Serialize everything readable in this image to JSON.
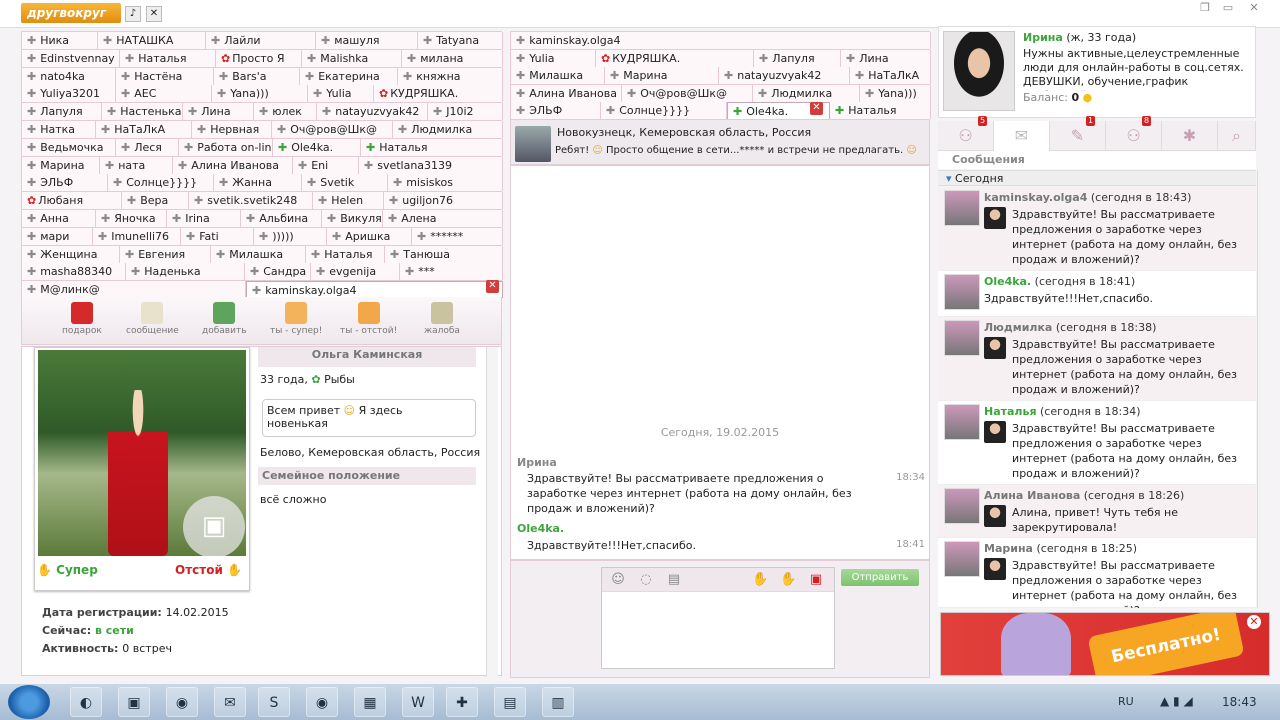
{
  "app": {
    "logo": "другвокруг"
  },
  "left_tabs": [
    [
      "Ника",
      "НАТАШКА",
      "Лайли",
      "машуля",
      "Tatyana"
    ],
    [
      "Edinstvennay",
      "Наталья",
      "Просто Я",
      "Malishka",
      "милана"
    ],
    [
      "nato4ka",
      "Настёна",
      "Bars'a",
      "Екатерина",
      "княжна"
    ],
    [
      "Yuliya3201",
      "AEC",
      "Yana)))",
      "Yulia",
      "КУДРЯШКА."
    ],
    [
      "Лапуля",
      "Настенька",
      "Лина",
      "юлек",
      "natayuzvyak42",
      "J10i2"
    ],
    [
      "Натка",
      "НаТаЛкА",
      "Нервная",
      "Оч@ров@Шк@",
      "Людмилка"
    ],
    [
      "Ведьмочка",
      "Леся",
      "Работа on-line",
      "Ole4ka.",
      "Наталья"
    ],
    [
      "Марина",
      "ната",
      "Алина Иванова",
      "Eni",
      "svetlana3139"
    ],
    [
      "ЭЛЬФ",
      "Солнце}}}}",
      "Жанна",
      "Svetik",
      "misiskos"
    ],
    [
      "Любаня",
      "Вера",
      "svetik.svetik248",
      "Helen",
      "ugiljon76"
    ],
    [
      "Анна",
      "Яночка",
      "Irina",
      "Альбина",
      "Викуля",
      "Алена"
    ],
    [
      "мари",
      "Imunelli76",
      "Fati",
      ")))))",
      "Аришка",
      "******"
    ],
    [
      "Женщина",
      "Евгения",
      "Милашка",
      "Наталья",
      "Танюша"
    ],
    [
      "masha88340",
      "Наденька",
      "Сандра",
      "evgenija",
      "***"
    ],
    [
      "M@линк@",
      "kaminskay.olga4"
    ]
  ],
  "toolbar": {
    "gift": "подарок",
    "message": "сообщение",
    "add": "добавить",
    "super": "ты - супер!",
    "bad": "ты - отстой!",
    "complaint": "жалоба"
  },
  "profile": {
    "name": "Ольга Каминская",
    "age_sign": "33 года,",
    "zodiac": "Рыбы",
    "status_msg": "Всем привет",
    "status_msg2": "Я здесь",
    "status_msg3": "новенькая",
    "location": "Белово, Кемеровская область, Россия",
    "family_header": "Семейное положение",
    "family_value": "всё сложно",
    "vote_super": "Супер",
    "vote_bad": "Отстой",
    "reg_label": "Дата регистрации:",
    "reg_value": "14.02.2015",
    "now_label": "Сейчас:",
    "now_value": "в сети",
    "activity_label": "Активность:",
    "activity_value": "0 встреч"
  },
  "mid_tabs": [
    [
      "kaminskay.olga4"
    ],
    [
      "Yulia",
      "КУДРЯШКА.",
      "Лапуля",
      "Лина"
    ],
    [
      "Милашка",
      "Марина",
      "natayuzvyak42",
      "НаТаЛкА"
    ],
    [
      "Алина Иванова",
      "Оч@ров@Шк@",
      "Людмилка",
      "Yana)))"
    ],
    [
      "ЭЛЬФ",
      "Солнце}}}}",
      "Ole4ka.",
      "Наталья"
    ]
  ],
  "chat": {
    "location": "Новокузнецк, Кемеровская область, Россия",
    "status": "Ребят!",
    "status2": "Просто общение в сети...***** и встречи не предлагать.",
    "date": "Сегодня, 19.02.2015",
    "m1_name": "Ирина",
    "m1_text": "Здравствуйте! Вы рассматриваете предложения о заработке через интернет (работа на дому онлайн, без продаж и вложений)?",
    "m1_time": "18:34",
    "m2_name": "Ole4ka.",
    "m2_text": "Здравствуйте!!!Нет,спасибо.",
    "m2_time": "18:41",
    "send": "Отправить"
  },
  "me": {
    "name": "Ирина",
    "info": "(ж, 33 года)",
    "about": "Нужны активные,целеустремленные люди для онлайн-работы в соц.сетях. ДЕВУШКИ, обучение,график свободный",
    "balance_label": "Баланс:",
    "balance": "0"
  },
  "rtabs": {
    "b1": "5",
    "b3": "1",
    "b4": "8"
  },
  "messages_header": "Сообщения",
  "today": "Сегодня",
  "messages": [
    {
      "name": "kaminskay.olga4",
      "when": "(сегодня в 18:43)",
      "text": "Здравствуйте! Вы рассматриваете предложения о заработке через интернет (работа на дому онлайн, без продаж и вложений)?"
    },
    {
      "name": "Ole4ka.",
      "when": "(сегодня в 18:41)",
      "text": "Здравствуйте!!!Нет,спасибо."
    },
    {
      "name": "Людмилка",
      "when": "(сегодня в 18:38)",
      "text": "Здравствуйте! Вы рассматриваете предложения о заработке через интернет (работа на дому онлайн, без продаж и вложений)?"
    },
    {
      "name": "Наталья",
      "when": "(сегодня в 18:34)",
      "text": "Здравствуйте! Вы рассматриваете предложения о заработке через интернет (работа на дому онлайн, без продаж и вложений)?"
    },
    {
      "name": "Алина Иванова",
      "when": "(сегодня в 18:26)",
      "text": "Алина, привет! Чуть тебя не зарекрутировала!"
    },
    {
      "name": "Марина",
      "when": "(сегодня в 18:25)",
      "text": "Здравствуйте! Вы рассматриваете предложения о заработке через интернет (работа на дому онлайн, без продаж и вложений)?"
    }
  ],
  "ad": {
    "text": "Бесплатно!"
  },
  "taskbar": {
    "lang": "RU",
    "clock": "18:43"
  }
}
